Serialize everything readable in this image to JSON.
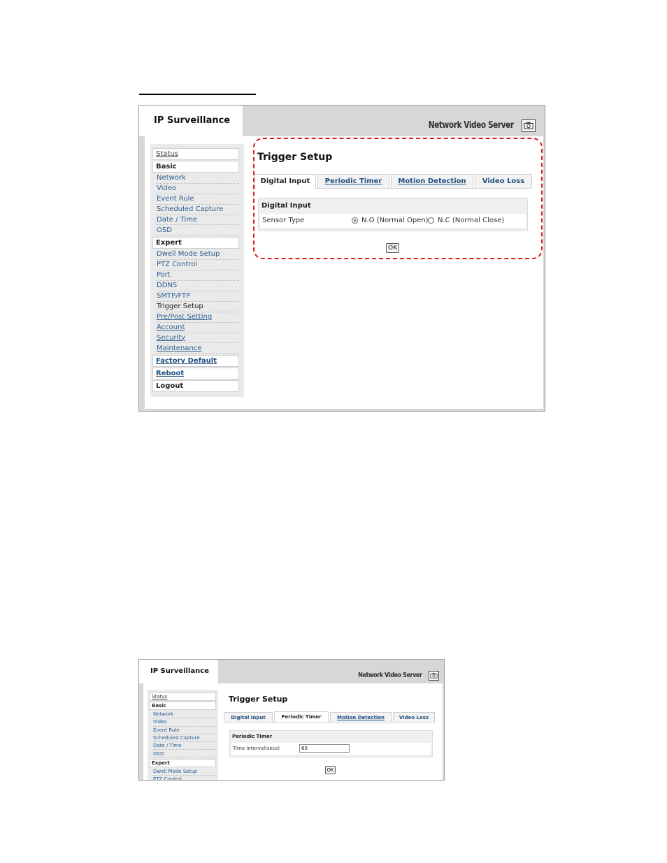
{
  "app_title": "IP Surveillance",
  "product_name": "Network Video Server",
  "icons": {
    "camera": "camera-icon"
  },
  "accent_color": "#1f4f80",
  "highlight_color": "#e01b1b",
  "sidebar": {
    "status": "Status",
    "basic_header": "Basic",
    "basic_items": [
      "Network",
      "Video",
      "Event Rule",
      "Scheduled Capture",
      "Date / Time",
      "OSD"
    ],
    "expert_header": "Expert",
    "expert_items": [
      "Dwell Mode Setup",
      "PTZ Control",
      "Port",
      "DDNS",
      "SMTP/FTP",
      "Trigger Setup",
      "Pre/Post Setting",
      "Account",
      "Security",
      "Maintenance"
    ],
    "factory_default": "Factory Default",
    "reboot": "Reboot",
    "logout": "Logout"
  },
  "page_title": "Trigger Setup",
  "tabs": [
    "Digital Input",
    "Periodic Timer",
    "Motion Detection",
    "Video Loss"
  ],
  "screen1": {
    "active_tab": "Digital Input",
    "section_title": "Digital Input",
    "field_label": "Sensor Type",
    "options": [
      "N.O (Normal Open)",
      "N.C (Normal Close)"
    ],
    "selected_option": "N.O (Normal Open)",
    "ok_label": "OK"
  },
  "screen2": {
    "active_tab": "Periodic Timer",
    "section_title": "Periodic Timer",
    "field_label": "Time Interval(secs)",
    "field_value": "60",
    "ok_label": "OK"
  }
}
